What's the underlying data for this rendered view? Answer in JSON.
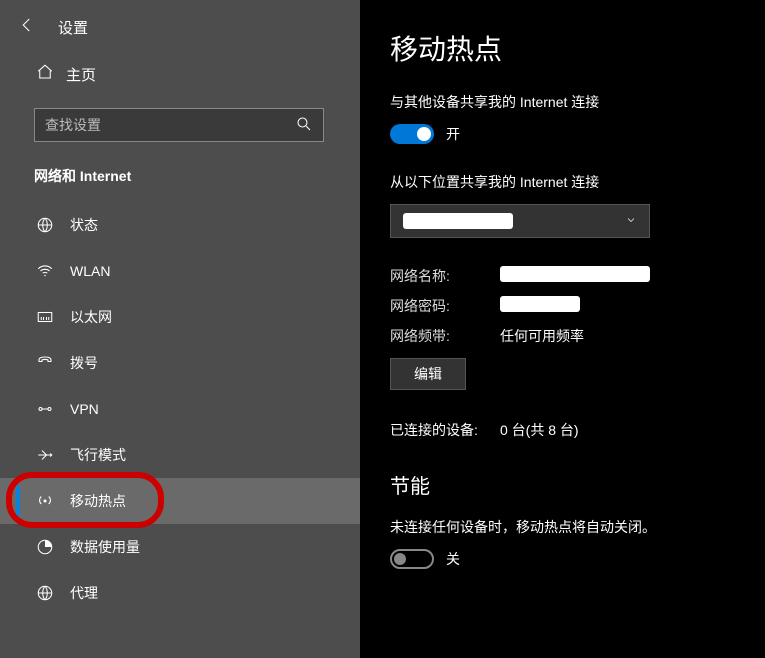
{
  "header": {
    "settings_label": "设置",
    "home_label": "主页",
    "search_placeholder": "查找设置",
    "category": "网络和 Internet"
  },
  "sidebar": {
    "items": [
      {
        "label": "状态"
      },
      {
        "label": "WLAN"
      },
      {
        "label": "以太网"
      },
      {
        "label": "拨号"
      },
      {
        "label": "VPN"
      },
      {
        "label": "飞行模式"
      },
      {
        "label": "移动热点"
      },
      {
        "label": "数据使用量"
      },
      {
        "label": "代理"
      }
    ]
  },
  "main": {
    "title": "移动热点",
    "share_label": "与其他设备共享我的 Internet 连接",
    "share_toggle_state": "开",
    "from_label": "从以下位置共享我的 Internet 连接",
    "network_name_label": "网络名称:",
    "network_name_value": "",
    "network_pwd_label": "网络密码:",
    "network_pwd_value": "",
    "network_band_label": "网络频带:",
    "network_band_value": "任何可用频率",
    "edit_button": "编辑",
    "connected_label": "已连接的设备:",
    "connected_value": "0 台(共 8 台)",
    "power_section": "节能",
    "power_desc": "未连接任何设备时，移动热点将自动关闭。",
    "power_toggle_state": "关"
  }
}
